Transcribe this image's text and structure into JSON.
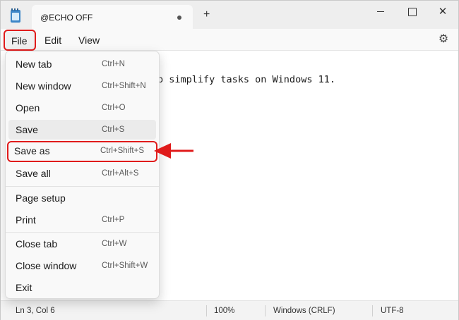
{
  "window": {
    "tab_title": "@ECHO OFF",
    "new_tab": "+",
    "close": "✕"
  },
  "menubar": {
    "file": "File",
    "edit": "Edit",
    "view": "View",
    "settings_icon": "⚙"
  },
  "editor": {
    "visible_text": "o simplify tasks on Windows 11."
  },
  "file_menu": {
    "items": [
      {
        "label": "New tab",
        "shortcut": "Ctrl+N"
      },
      {
        "label": "New window",
        "shortcut": "Ctrl+Shift+N"
      },
      {
        "label": "Open",
        "shortcut": "Ctrl+O"
      },
      {
        "label": "Save",
        "shortcut": "Ctrl+S"
      },
      {
        "label": "Save as",
        "shortcut": "Ctrl+Shift+S"
      },
      {
        "label": "Save all",
        "shortcut": "Ctrl+Alt+S"
      },
      {
        "label": "Page setup",
        "shortcut": ""
      },
      {
        "label": "Print",
        "shortcut": "Ctrl+P"
      },
      {
        "label": "Close tab",
        "shortcut": "Ctrl+W"
      },
      {
        "label": "Close window",
        "shortcut": "Ctrl+Shift+W"
      },
      {
        "label": "Exit",
        "shortcut": ""
      }
    ]
  },
  "statusbar": {
    "position": "Ln 3, Col 6",
    "zoom": "100%",
    "line_ending": "Windows (CRLF)",
    "encoding": "UTF-8"
  },
  "colors": {
    "highlight": "#e01b1b",
    "hover": "#ebebeb"
  }
}
